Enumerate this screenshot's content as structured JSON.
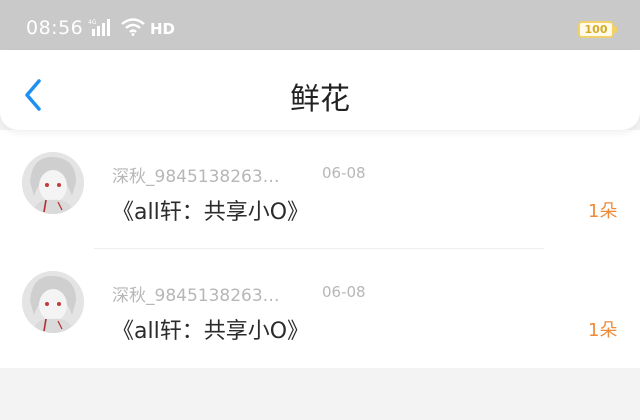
{
  "status_bar": {
    "time": "08:56",
    "network": "4G",
    "hd": "HD",
    "battery": "100"
  },
  "nav": {
    "back_icon": "chevron-left-icon",
    "title": "鲜花"
  },
  "items": [
    {
      "username": "深秋_9845138263…",
      "date": "06-08",
      "title": "《all轩：共享小O》",
      "count": "1朵"
    },
    {
      "username": "深秋_9845138263…",
      "date": "06-08",
      "title": "《all轩：共享小O》",
      "count": "1朵"
    }
  ],
  "colors": {
    "accent": "#1e90f0",
    "count": "#ef8a3a",
    "muted_text": "#b7b7b7",
    "status_bar": "#c9c9c9"
  }
}
